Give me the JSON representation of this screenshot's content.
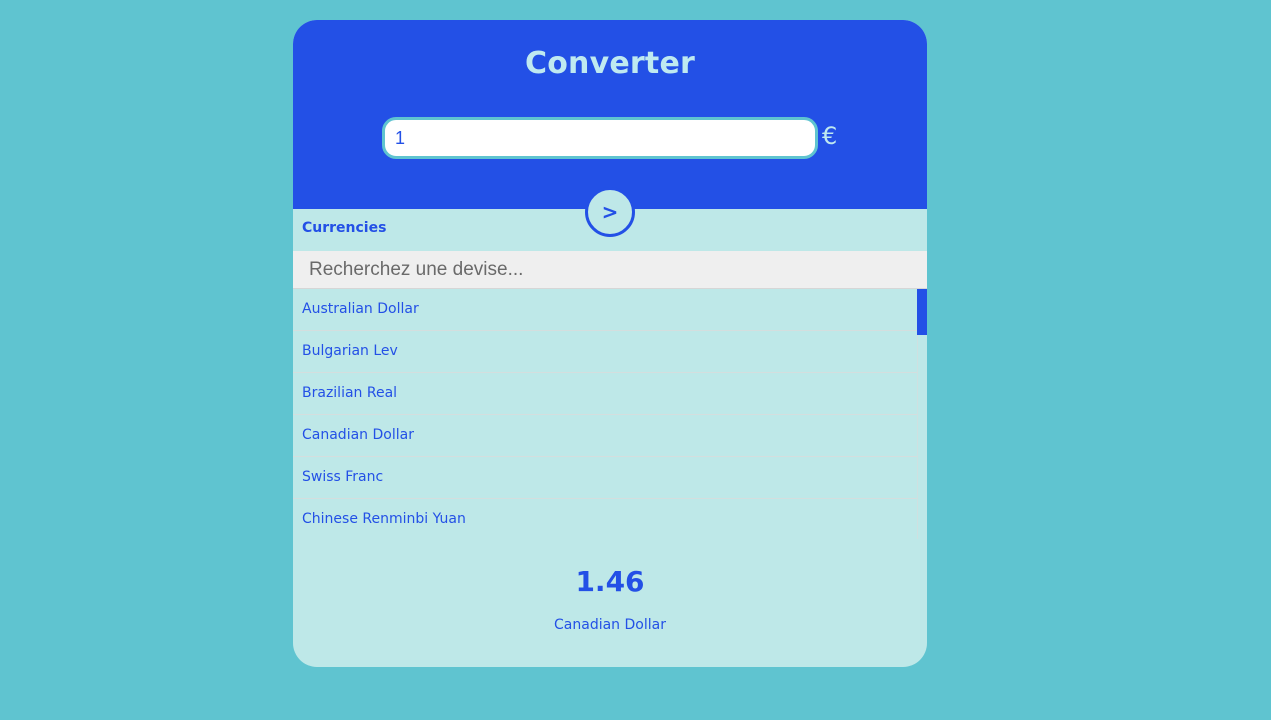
{
  "header": {
    "title": "Converter",
    "amount_value": "1",
    "currency_symbol": "€"
  },
  "convert_button": {
    "label": ">"
  },
  "currencies": {
    "label": "Currencies",
    "search_placeholder": "Recherchez une devise...",
    "items": [
      "Australian Dollar",
      "Bulgarian Lev",
      "Brazilian Real",
      "Canadian Dollar",
      "Swiss Franc",
      "Chinese Renminbi Yuan"
    ]
  },
  "result": {
    "value": "1.46",
    "currency": "Canadian Dollar"
  },
  "colors": {
    "page_background": "#5fc4d0",
    "accent": "#2350e6",
    "panel": "#bee8e8",
    "header_text": "#bfe9f0"
  }
}
